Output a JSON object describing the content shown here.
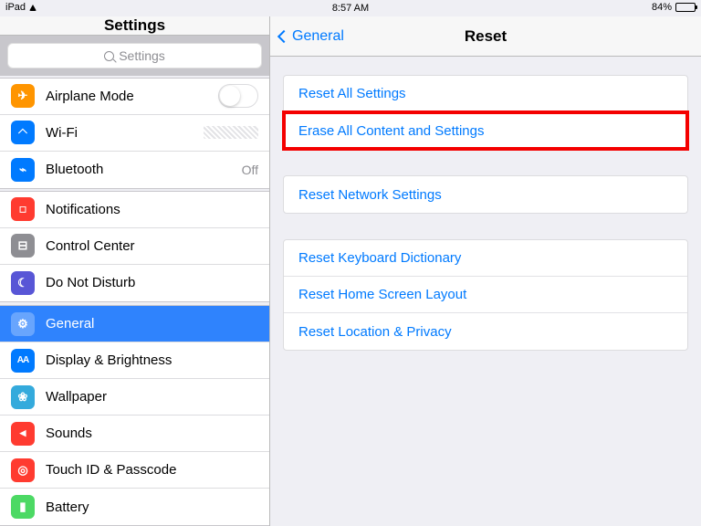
{
  "status": {
    "device": "iPad",
    "time": "8:57 AM",
    "battery_pct": "84%"
  },
  "left": {
    "title": "Settings",
    "search_placeholder": "Settings",
    "group1": [
      {
        "label": "Airplane Mode",
        "accessory": "toggle",
        "icon": "ic-orange g-plane"
      },
      {
        "label": "Wi-Fi",
        "accessory": "wifi",
        "icon": "ic-blue g-wifi"
      },
      {
        "label": "Bluetooth",
        "accessory": "text",
        "acc_text": "Off",
        "icon": "ic-blue g-bt"
      }
    ],
    "group2": [
      {
        "label": "Notifications",
        "icon": "ic-red g-bell"
      },
      {
        "label": "Control Center",
        "icon": "ic-grey g-cc"
      },
      {
        "label": "Do Not Disturb",
        "icon": "ic-purple g-moon"
      }
    ],
    "group3": [
      {
        "label": "General",
        "icon": "ic-grey g-gear",
        "selected": true
      },
      {
        "label": "Display & Brightness",
        "icon": "ic-blue g-aa"
      },
      {
        "label": "Wallpaper",
        "icon": "ic-lblue g-wall"
      },
      {
        "label": "Sounds",
        "icon": "ic-red g-snd"
      },
      {
        "label": "Touch ID & Passcode",
        "icon": "ic-red g-touch"
      },
      {
        "label": "Battery",
        "icon": "ic-green g-batt"
      }
    ]
  },
  "right": {
    "back_label": "General",
    "title": "Reset",
    "groups": [
      [
        {
          "label": "Reset All Settings"
        },
        {
          "label": "Erase All Content and Settings",
          "highlight": true
        }
      ],
      [
        {
          "label": "Reset Network Settings"
        }
      ],
      [
        {
          "label": "Reset Keyboard Dictionary"
        },
        {
          "label": "Reset Home Screen Layout"
        },
        {
          "label": "Reset Location & Privacy"
        }
      ]
    ]
  }
}
